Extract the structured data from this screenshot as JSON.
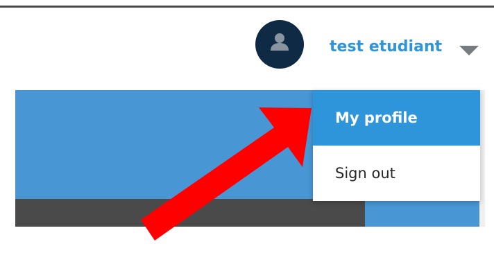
{
  "header": {
    "user_name": "test etudiant",
    "avatar_icon": "user-icon",
    "caret_icon": "caret-down-icon"
  },
  "dropdown": {
    "items": [
      {
        "label": "My profile",
        "active": true
      },
      {
        "label": "Sign out",
        "active": false
      }
    ]
  },
  "annotation": {
    "icon": "arrow-icon",
    "color": "#ff0000"
  },
  "colors": {
    "header_rule": "#4a4a4a",
    "avatar_bg": "#0f2a45",
    "avatar_fg": "#8a949f",
    "user_name": "#2f95db",
    "caret": "#777b82",
    "active_menu_bg": "#2f95db",
    "menu_text": "#262626",
    "blue_band": "#4896d4",
    "dark_band": "#4a4a4a"
  }
}
